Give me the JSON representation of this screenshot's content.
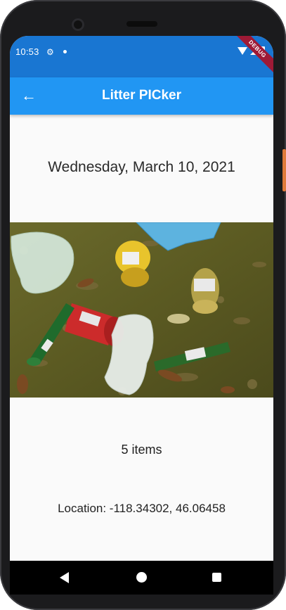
{
  "status_bar": {
    "time": "10:53",
    "icons": [
      "gear-icon",
      "notification-dot-icon",
      "wifi-icon",
      "signal-icon",
      "battery-icon"
    ],
    "debug_banner": "DEBUG"
  },
  "app_bar": {
    "title": "Litter PICker",
    "back_icon": "arrow-back-icon"
  },
  "content": {
    "date": "Wednesday, March 10, 2021",
    "photo_subject": "litter-on-grass-photo",
    "items": "5 items",
    "location": "Location: -118.34302, 46.06458"
  },
  "nav_bar": {
    "icons": [
      "back-triangle-icon",
      "home-circle-icon",
      "recents-square-icon"
    ]
  },
  "colors": {
    "status_bar": "#1976d2",
    "app_bar": "#2196f3",
    "background": "#fafafa",
    "debug_ribbon": "#9e1a36"
  }
}
